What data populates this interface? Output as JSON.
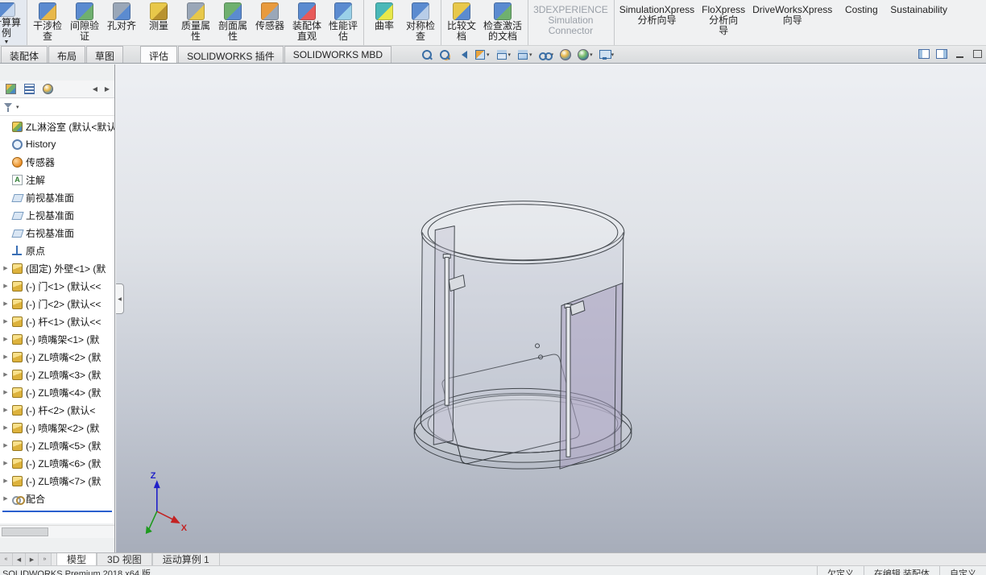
{
  "ribbon": {
    "items": [
      {
        "label": "计算算\n例",
        "icon": "computation-study-icon",
        "colors": [
          "#5b8bd0",
          "#c9d9ee"
        ],
        "flyout": true,
        "clipped": true,
        "separator_after": true
      },
      {
        "label": "干涉检\n查",
        "icon": "interference-detection-icon",
        "colors": [
          "#5b8bd0",
          "#e8b84a"
        ]
      },
      {
        "label": "间隙验\n证",
        "icon": "clearance-verification-icon",
        "colors": [
          "#5b8bd0",
          "#6fb06f"
        ]
      },
      {
        "label": "孔对齐",
        "icon": "hole-alignment-icon",
        "colors": [
          "#9aa7b8",
          "#5b8bd0"
        ]
      },
      {
        "label": "测量",
        "icon": "measure-icon",
        "colors": [
          "#e8c84a",
          "#b8922e"
        ]
      },
      {
        "label": "质量属\n性",
        "icon": "mass-properties-icon",
        "colors": [
          "#9aa7b8",
          "#e8c84a"
        ]
      },
      {
        "label": "剖面属\n性",
        "icon": "section-properties-icon",
        "colors": [
          "#6fb06f",
          "#5b8bd0"
        ]
      },
      {
        "label": "传感器",
        "icon": "sensor-icon",
        "colors": [
          "#e89a3d",
          "#9aa7b8"
        ]
      },
      {
        "label": "装配体\n直观",
        "icon": "assembly-visualization-icon",
        "colors": [
          "#5b8bd0",
          "#e85a5a"
        ]
      },
      {
        "label": "性能评\n估",
        "icon": "performance-evaluation-icon",
        "colors": [
          "#5b8bd0",
          "#9ad0e8"
        ],
        "separator_after": true
      },
      {
        "label": "曲率",
        "icon": "curvature-icon",
        "colors": [
          "#4ab8b8",
          "#e8e84a"
        ]
      },
      {
        "label": "对称检\n查",
        "icon": "symmetry-check-icon",
        "colors": [
          "#5b8bd0",
          "#b8cde8"
        ],
        "separator_after": true
      },
      {
        "label": "比较文\n档",
        "icon": "compare-documents-icon",
        "colors": [
          "#e8c84a",
          "#5b8bd0"
        ]
      },
      {
        "label": "检查激活\n的文档",
        "icon": "check-active-document-icon",
        "colors": [
          "#5b8bd0",
          "#6fb06f"
        ],
        "separator_after": true
      },
      {
        "label": "3DEXPERIENCE\nSimulation\nConnector",
        "text_only": true,
        "disabled": true,
        "separator_after": true
      },
      {
        "label": "SimulationXpress\n分析向导",
        "text_only": true
      },
      {
        "label": "FloXpress\n分析向\n导",
        "text_only": true
      },
      {
        "label": "DriveWorksXpress\n向导",
        "text_only": true
      },
      {
        "label": "Costing",
        "text_only": true
      },
      {
        "label": "Sustainability",
        "text_only": true
      }
    ]
  },
  "command_tabs": {
    "items": [
      {
        "label": "装配体"
      },
      {
        "label": "布局"
      },
      {
        "label": "草图"
      },
      {
        "label": "评估",
        "active": true,
        "gap_before": true
      },
      {
        "label": "SOLIDWORKS 插件"
      },
      {
        "label": "SOLIDWORKS MBD"
      }
    ]
  },
  "headsup_toolbar": {
    "icons": [
      "zoom-fit-icon",
      "zoom-area-icon",
      "previous-view-icon",
      "section-view-icon",
      "view-orientation-icon",
      "display-style-icon",
      "hide-show-items-icon",
      "edit-appearance-icon",
      "apply-scene-icon",
      "view-settings-icon"
    ]
  },
  "window_controls": {
    "icons": [
      "collapse-pane-left-icon",
      "collapse-pane-right-icon",
      "minimize-icon",
      "restore-icon"
    ]
  },
  "feature_panel": {
    "tab_icons": [
      "featuremanager-tree-icon",
      "property-manager-icon",
      "display-manager-icon"
    ],
    "nav_icons": [
      "previous-pane-arrow-icon",
      "next-pane-arrow-icon"
    ],
    "filter_icon": "filter-funnel-icon"
  },
  "feature_tree": {
    "items": [
      {
        "label": "ZL淋浴室 (默认<默认_",
        "icon": "assembly"
      },
      {
        "label": "History",
        "icon": "history"
      },
      {
        "label": "传感器",
        "icon": "sensor"
      },
      {
        "label": "注解",
        "icon": "annotation"
      },
      {
        "label": "前视基准面",
        "icon": "plane"
      },
      {
        "label": "上视基准面",
        "icon": "plane"
      },
      {
        "label": "右视基准面",
        "icon": "plane"
      },
      {
        "label": "原点",
        "icon": "origin"
      },
      {
        "label": "(固定) 外壁<1> (默",
        "icon": "part",
        "expand": true
      },
      {
        "label": "(-) 门<1> (默认<<",
        "icon": "part",
        "expand": true
      },
      {
        "label": "(-) 门<2> (默认<<",
        "icon": "part",
        "expand": true
      },
      {
        "label": "(-) 杆<1> (默认<<",
        "icon": "part",
        "expand": true
      },
      {
        "label": "(-) 喷嘴架<1> (默",
        "icon": "part",
        "expand": true
      },
      {
        "label": "(-) ZL喷嘴<2> (默",
        "icon": "part",
        "expand": true
      },
      {
        "label": "(-) ZL喷嘴<3> (默",
        "icon": "part",
        "expand": true
      },
      {
        "label": "(-) ZL喷嘴<4> (默",
        "icon": "part",
        "expand": true
      },
      {
        "label": "(-) 杆<2> (默认<",
        "icon": "part",
        "expand": true
      },
      {
        "label": "(-) 喷嘴架<2> (默",
        "icon": "part",
        "expand": true
      },
      {
        "label": "(-) ZL喷嘴<5> (默",
        "icon": "part",
        "expand": true
      },
      {
        "label": "(-) ZL喷嘴<6> (默",
        "icon": "part",
        "expand": true
      },
      {
        "label": "(-) ZL喷嘴<7> (默",
        "icon": "part",
        "expand": true
      },
      {
        "label": "配合",
        "icon": "mates",
        "expand": true
      }
    ]
  },
  "viewport": {
    "triad": {
      "x_label": "X",
      "z_label": "Z"
    }
  },
  "bottom_tabs": {
    "nav_icons": [
      "go-first-icon",
      "go-previous-icon",
      "go-next-icon",
      "go-last-icon"
    ],
    "items": [
      {
        "label": "模型",
        "active": true
      },
      {
        "label": "3D 视图"
      },
      {
        "label": "运动算例 1"
      }
    ]
  },
  "status_bar": {
    "left": "SOLIDWORKS Premium 2018 x64 版",
    "right": [
      "欠定义",
      "在编辑 装配体",
      "自定义"
    ]
  }
}
